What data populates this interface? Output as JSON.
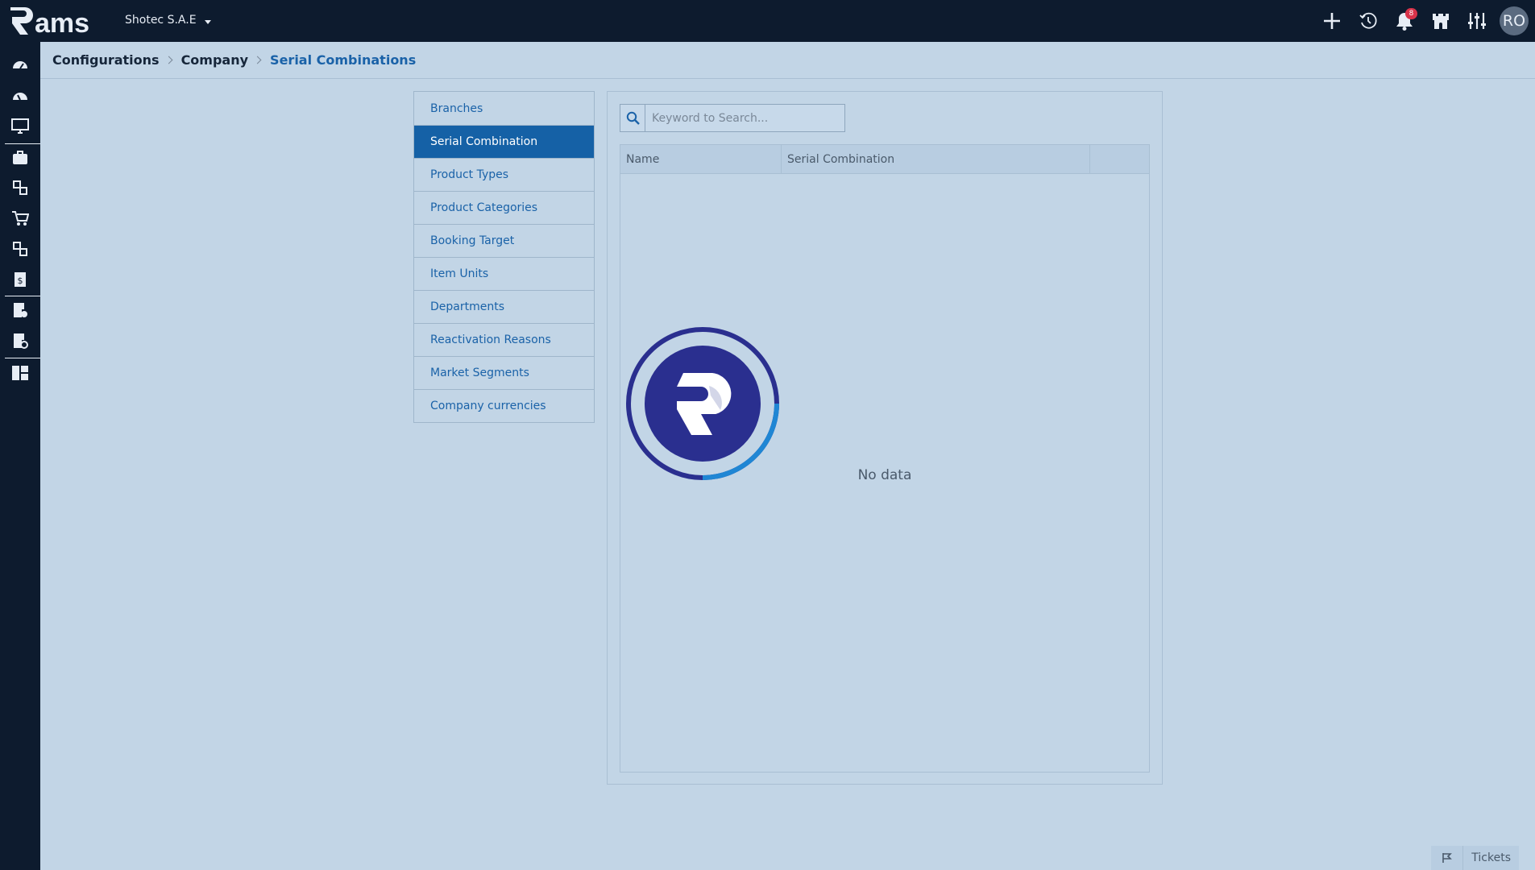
{
  "app": {
    "logo_text": "Rams"
  },
  "company_selector": {
    "value": "Shotec S.A.E"
  },
  "top_bar": {
    "icons": [
      "plus-icon",
      "history-icon",
      "bell-icon",
      "castle-icon",
      "sliders-icon"
    ],
    "notification_count": "8",
    "avatar_initials": "RO"
  },
  "sidebar": {
    "icons": [
      "dashboard-icon",
      "dashboard-alt-icon",
      "monitor-icon",
      "briefcase-icon",
      "modules-icon",
      "cart-icon",
      "modules-alt-icon",
      "invoice-icon",
      "report-check-icon",
      "report-settings-icon",
      "grid-report-icon"
    ]
  },
  "breadcrumb": {
    "items": [
      "Configurations",
      "Company",
      "Serial Combinations"
    ]
  },
  "menu": {
    "items": [
      "Branches",
      "Serial Combination",
      "Product Types",
      "Product Categories",
      "Booking Target",
      "Item Units",
      "Departments",
      "Reactivation Reasons",
      "Market Segments",
      "Company currencies"
    ],
    "active_index": 1
  },
  "search": {
    "placeholder": "Keyword to Search..."
  },
  "table": {
    "columns": [
      "Name",
      "Serial Combination",
      ""
    ],
    "rows": [],
    "empty_text": "No data"
  },
  "tickets": {
    "label": "Tickets"
  },
  "colors": {
    "topbar": "#0d1b2e",
    "background": "#c2d5e6",
    "accent": "#1561a6",
    "loader": "#2a2f8f"
  }
}
